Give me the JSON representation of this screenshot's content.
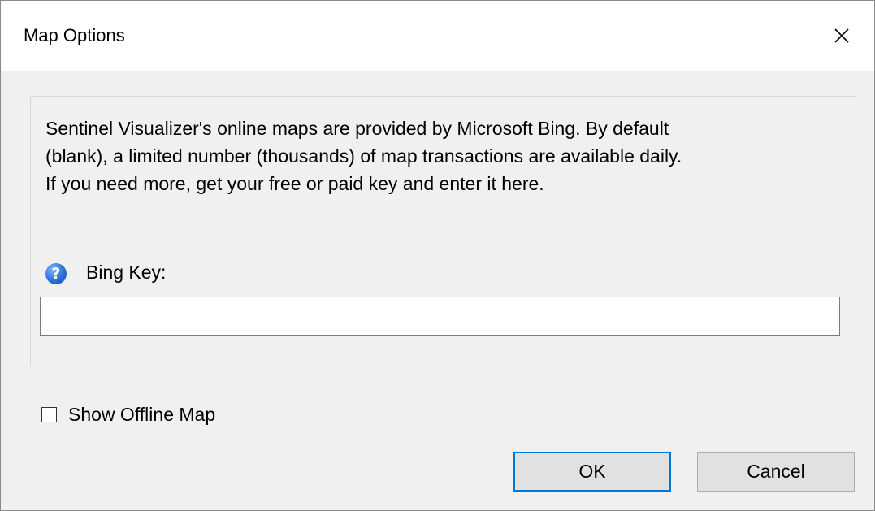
{
  "window": {
    "title": "Map Options",
    "close_icon": "close-icon"
  },
  "info_group": {
    "description_lines": [
      "Sentinel Visualizer's online maps are provided by Microsoft Bing. By default",
      "(blank), a limited number (thousands) of map transactions are available daily.",
      "If you need more, get your free or paid key and enter it here."
    ],
    "help_icon": "help-icon",
    "help_glyph": "?",
    "bing_key_label": "Bing Key:",
    "bing_key_value": "",
    "bing_key_placeholder": ""
  },
  "options": {
    "show_offline_map_label": "Show Offline Map",
    "show_offline_map_checked": false
  },
  "buttons": {
    "ok_label": "OK",
    "cancel_label": "Cancel"
  },
  "colors": {
    "focus_border": "#0078d7",
    "dialog_background": "#f0f0f0",
    "titlebar_background": "#ffffff"
  }
}
